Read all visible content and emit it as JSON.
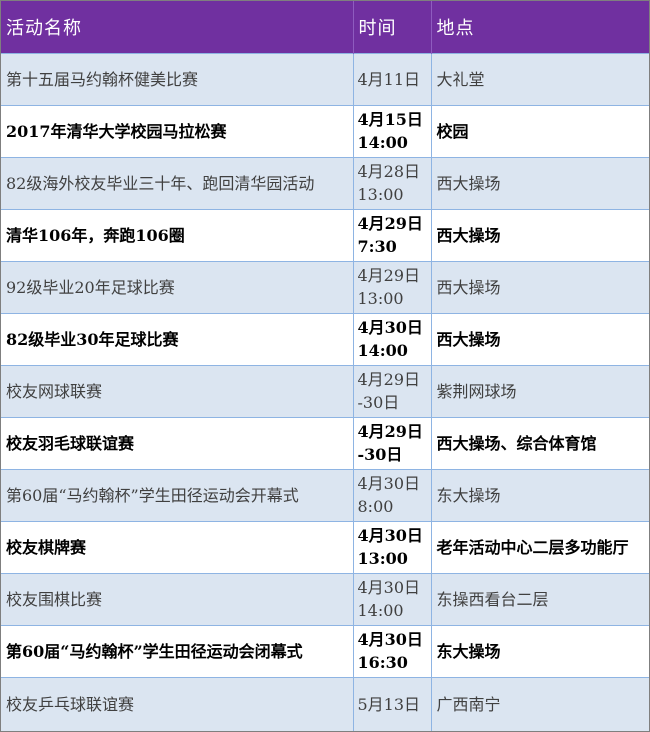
{
  "header": {
    "name": "活动名称",
    "time": "时间",
    "place": "地点"
  },
  "rows": [
    {
      "name": "第十五届马约翰杯健美比赛",
      "time": "4月11日",
      "place": "大礼堂",
      "bold": false
    },
    {
      "name": "2017年清华大学校园马拉松赛",
      "time": "4月15日 14:00",
      "place": "校园",
      "bold": true
    },
    {
      "name": "82级海外校友毕业三十年、跑回清华园活动",
      "time": "4月28日 13:00",
      "place": "西大操场",
      "bold": false
    },
    {
      "name": "清华106年，奔跑106圈",
      "time": "4月29日 7:30",
      "place": "西大操场",
      "bold": true
    },
    {
      "name": "92级毕业20年足球比赛",
      "time": "4月29日 13:00",
      "place": "西大操场",
      "bold": false
    },
    {
      "name": "82级毕业30年足球比赛",
      "time": "4月30日 14:00",
      "place": "西大操场",
      "bold": true
    },
    {
      "name": "校友网球联赛",
      "time": "4月29日 -30日",
      "place": "紫荆网球场",
      "bold": false
    },
    {
      "name": "校友羽毛球联谊赛",
      "time": "4月29日 -30日",
      "place": "西大操场、综合体育馆",
      "bold": true
    },
    {
      "name": "第60届“马约翰杯”学生田径运动会开幕式",
      "time": "4月30日 8:00",
      "place": "东大操场",
      "bold": false
    },
    {
      "name": "校友棋牌赛",
      "time": "4月30日 13:00",
      "place": "老年活动中心二层多功能厅",
      "bold": true
    },
    {
      "name": "校友围棋比赛",
      "time": "4月30日 14:00",
      "place": "东操西看台二层",
      "bold": false
    },
    {
      "name": "第60届“马约翰杯”学生田径运动会闭幕式",
      "time": "4月30日 16:30",
      "place": "东大操场",
      "bold": true
    },
    {
      "name": "校友乒乓球联谊赛",
      "time": "5月13日",
      "place": "广西南宁",
      "bold": false
    }
  ]
}
